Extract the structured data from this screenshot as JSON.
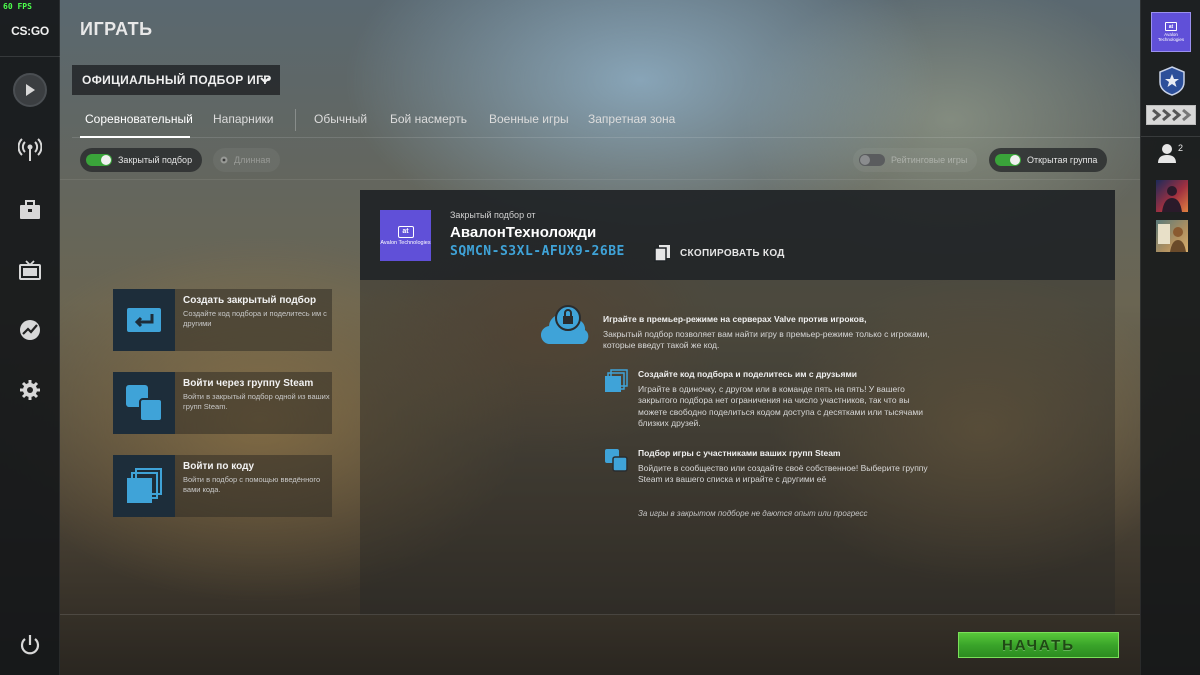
{
  "hud": {
    "fps": "60 FPS"
  },
  "brand": {
    "logo": "CS:GO"
  },
  "header": {
    "title": "ИГРАТЬ"
  },
  "mode_select": {
    "value": "ОФИЦИАЛЬНЫЙ ПОДБОР ИГР"
  },
  "tabs": [
    {
      "label": "Соревновательный",
      "active": true
    },
    {
      "label": "Напарники"
    },
    {
      "label": "Обычный"
    },
    {
      "label": "Бой насмерть"
    },
    {
      "label": "Военные игры"
    },
    {
      "label": "Запретная зона"
    }
  ],
  "filters": {
    "private": {
      "label": "Закрытый подбор",
      "on": true
    },
    "long": {
      "label": "Длинная",
      "enabled": false
    },
    "ranked": {
      "label": "Рейтинговые игры",
      "on": false
    },
    "open_group": {
      "label": "Открытая группа",
      "on": true
    }
  },
  "actions": [
    {
      "title": "Создать закрытый подбор",
      "subtitle": "Создайте код подбора и поделитесь им с другими",
      "icon": "enter-icon"
    },
    {
      "title": "Войти через группу Steam",
      "subtitle": "Войти в закрытый подбор одной из ваших групп Steam.",
      "icon": "group-squares-icon"
    },
    {
      "title": "Войти по коду",
      "subtitle": "Войти в подбор с помощью введённого вами кода.",
      "icon": "stack-squares-icon"
    }
  ],
  "lobby": {
    "label": "Закрытый подбор от",
    "owner": "АвалонТехноложди",
    "code": "SQMCN-S3XL-AFUX9-26BE",
    "copy_label": "СКОПИРОВАТЬ КОД",
    "avatar_text": "Avalon Technologies",
    "avatar_mark": "at"
  },
  "info": {
    "premier": {
      "title": "Играйте в премьер-режиме на серверах Valve против игроков,",
      "body": "Закрытый подбор позволяет вам найти игру в премьер-режиме только с игроками, которые введут такой же код."
    },
    "share": {
      "title": "Создайте код подбора и поделитесь им с друзьями",
      "body": "Играйте в одиночку, с другом или в команде пять на пять! У вашего закрытого подбора нет ограничения на число участников, так что вы можете свободно поделиться кодом доступа с десятками или тысячами близких друзей."
    },
    "groups": {
      "title": "Подбор игры с участниками ваших групп Steam",
      "body": "Войдите в сообщество или создайте своё собственное! Выберите группу Steam из вашего списка и играйте с другими её"
    },
    "note": "За игры в закрытом подборе не даются опыт или прогресс"
  },
  "start_button": {
    "label": "НАЧАТЬ"
  },
  "right_rail": {
    "friends_count": "2"
  },
  "colors": {
    "accent": "#3fa3d8",
    "start": "#3aa42a",
    "toggle_on": "#3aa43a",
    "avatar": "#6050d8"
  }
}
